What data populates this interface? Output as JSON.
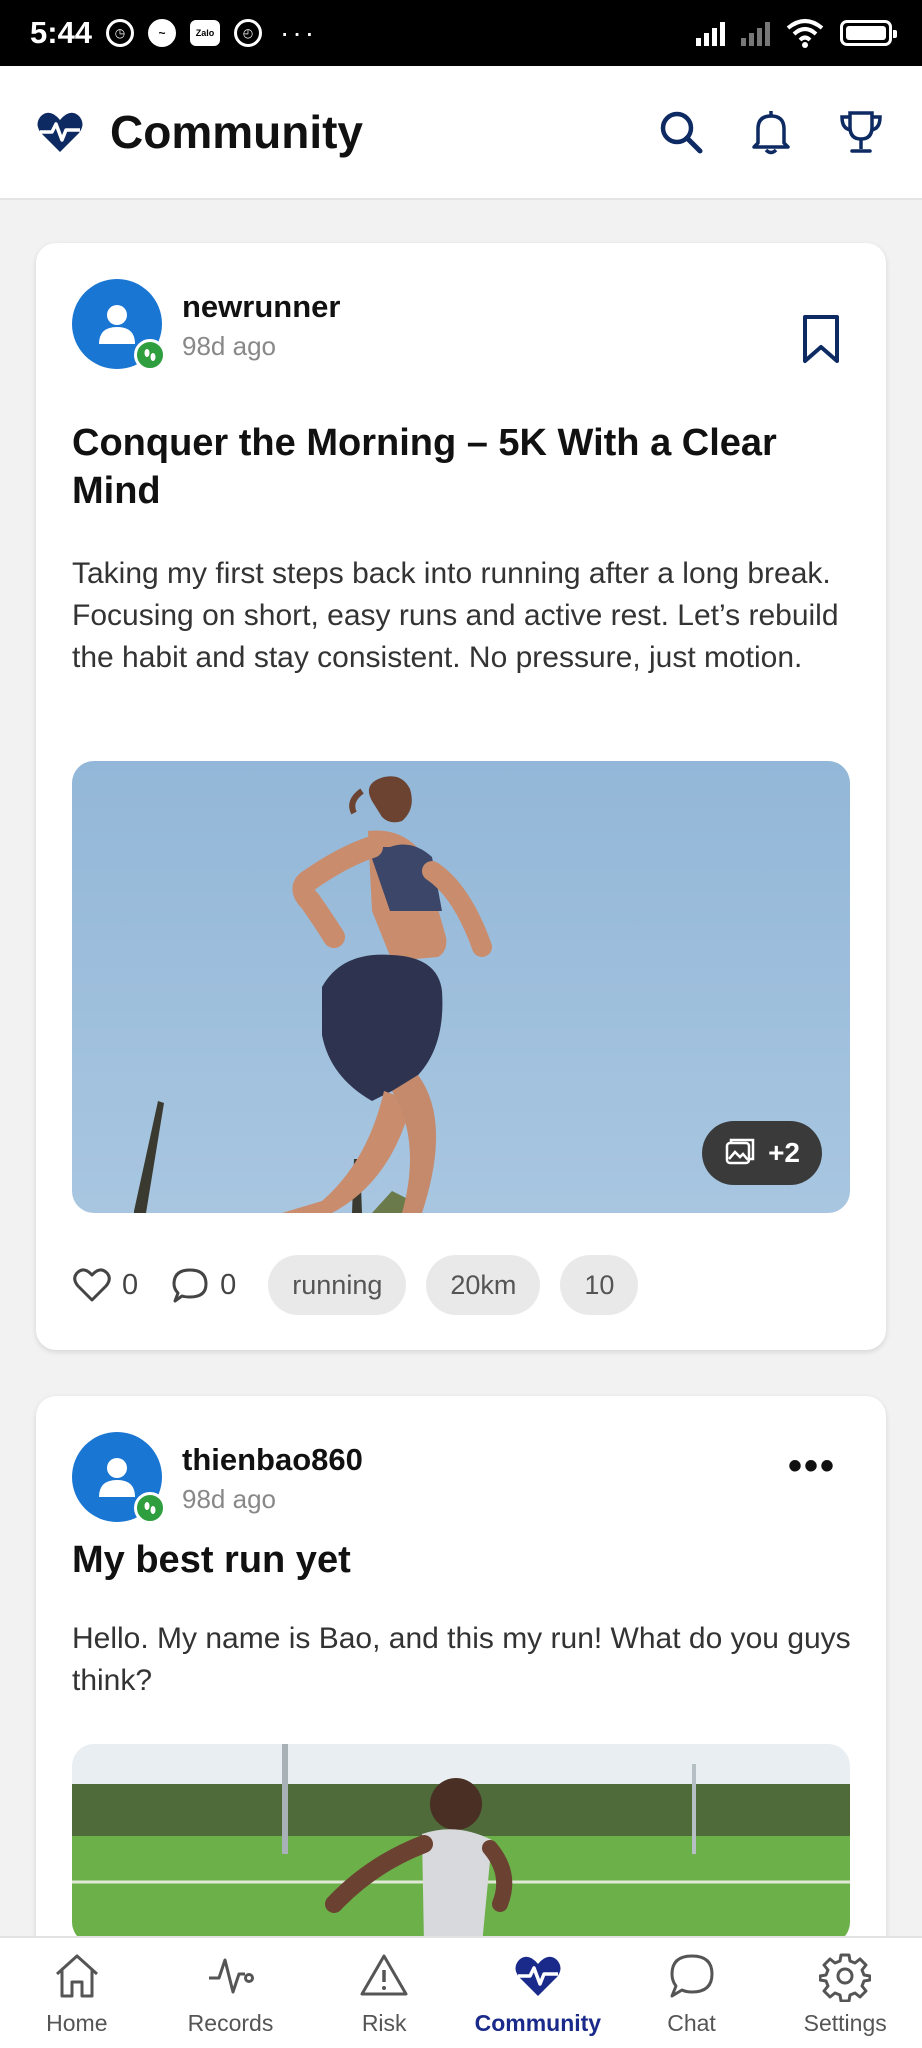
{
  "status_bar": {
    "time": "5:44",
    "dots": "···",
    "zalo_label": "Zalo"
  },
  "header": {
    "title": "Community",
    "icons": [
      "heartbeat-logo-icon",
      "search-icon",
      "bell-icon",
      "trophy-icon"
    ],
    "accent_color": "#0d2a63"
  },
  "posts": [
    {
      "author": "newrunner",
      "time": "98d ago",
      "title": "Conquer the Morning – 5K With a Clear Mind",
      "body": "Taking my first steps back into running after a long break. Focusing on short, easy runs and active rest. Let’s rebuild the habit and stay consistent. No pressure, just motion.",
      "image_extra_count": "+2",
      "likes": "0",
      "comments": "0",
      "tags": [
        "running",
        "20km",
        "10"
      ]
    },
    {
      "author": "thienbao860",
      "time": "98d ago",
      "title": "My best run yet",
      "body": "Hello. My name is Bao, and this my run! What do you guys think?"
    }
  ],
  "bottom_nav": {
    "items": [
      {
        "label": "Home",
        "icon": "home-icon"
      },
      {
        "label": "Records",
        "icon": "pulse-icon"
      },
      {
        "label": "Risk",
        "icon": "warning-icon"
      },
      {
        "label": "Community",
        "icon": "heartbeat-icon"
      },
      {
        "label": "Chat",
        "icon": "chat-icon"
      },
      {
        "label": "Settings",
        "icon": "gear-icon"
      }
    ],
    "active": "Community",
    "active_color": "#1a2a8a"
  }
}
